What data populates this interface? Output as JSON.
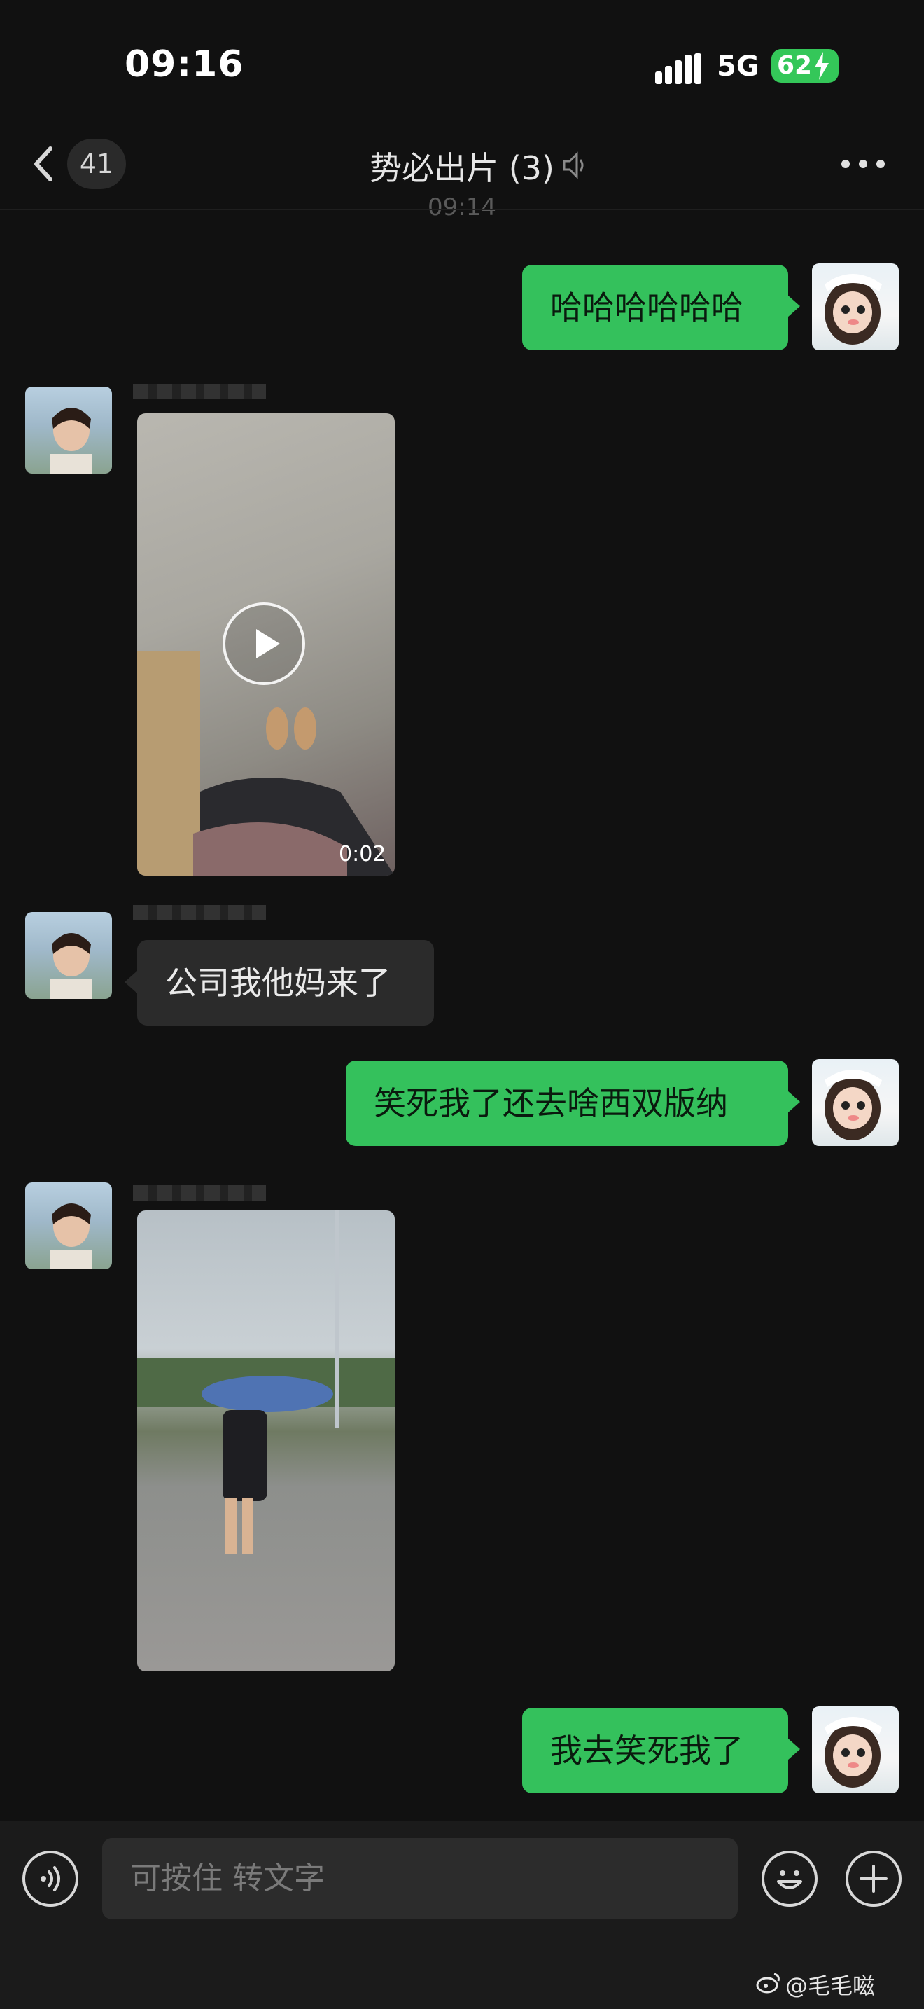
{
  "status_bar": {
    "time": "09:16",
    "network": "5G",
    "battery": "62"
  },
  "nav": {
    "back_badge": "41",
    "title": "势必出片 (3)"
  },
  "timestamp": "09:14",
  "messages": [
    {
      "from": "me",
      "type": "text",
      "text": "哈哈哈哈哈哈"
    },
    {
      "from": "other",
      "type": "video",
      "duration": "0:02"
    },
    {
      "from": "other",
      "type": "text",
      "text": "公司我他妈来了"
    },
    {
      "from": "me",
      "type": "text",
      "text": "笑死我了还去啥西双版纳"
    },
    {
      "from": "other",
      "type": "image"
    },
    {
      "from": "me",
      "type": "text",
      "text": "我去笑死我了"
    }
  ],
  "input": {
    "placeholder": "可按住 转文字"
  },
  "watermark": "@毛毛嗞",
  "colors": {
    "background": "#111111",
    "my_bubble": "#34c15c",
    "other_bubble": "#2b2b2b",
    "battery": "#34c759"
  },
  "icons": [
    "back-chevron-icon",
    "mute-icon",
    "more-icon",
    "voice-icon",
    "emoji-icon",
    "plus-icon",
    "play-icon",
    "weibo-icon"
  ]
}
